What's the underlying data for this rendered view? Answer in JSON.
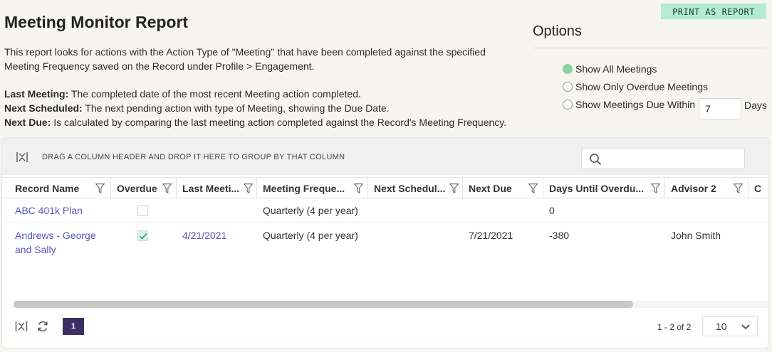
{
  "toolbar": {
    "print_label": "PRINT AS REPORT"
  },
  "page": {
    "title": "Meeting Monitor Report",
    "description": "This report looks for actions with the Action Type of \"Meeting\" that have been completed against the specified Meeting Frequency saved on the Record under Profile > Engagement.",
    "definitions": [
      {
        "term": "Last Meeting:",
        "text": " The completed date of the most recent Meeting action completed."
      },
      {
        "term": "Next Scheduled:",
        "text": " The next pending action with type of Meeting, showing the Due Date."
      },
      {
        "term": "Next Due:",
        "text": " Is calculated by comparing the last meeting action completed against the Record's Meeting Frequency."
      }
    ]
  },
  "options": {
    "title": "Options",
    "radios": [
      {
        "label": "Show All Meetings",
        "checked": true
      },
      {
        "label": "Show Only Overdue Meetings",
        "checked": false
      },
      {
        "label": "Show Meetings Due Within",
        "checked": false
      }
    ],
    "days_value": "7",
    "days_suffix": "Days"
  },
  "grid": {
    "group_hint": "DRAG A COLUMN HEADER AND DROP IT HERE TO GROUP BY THAT COLUMN",
    "search_value": "",
    "columns": [
      "Record Name",
      "Overdue",
      "Last Meeti...",
      "Meeting Freque...",
      "Next Schedul...",
      "Next Due",
      "Days Until Overdu...",
      "Advisor 2",
      "C"
    ],
    "rows": [
      {
        "record_name": "ABC 401k Plan",
        "overdue": false,
        "last_meeting": "",
        "frequency": "Quarterly (4 per year)",
        "next_scheduled": "",
        "next_due": "",
        "days_until_overdue": "0",
        "advisor2": ""
      },
      {
        "record_name": "Andrews - George and Sally",
        "overdue": true,
        "last_meeting": "4/21/2021",
        "frequency": "Quarterly (4 per year)",
        "next_scheduled": "",
        "next_due": "7/21/2021",
        "days_until_overdue": "-380",
        "advisor2": "John Smith"
      }
    ],
    "pager": {
      "current_page": "1",
      "info": "1 - 2 of 2",
      "page_size": "10"
    }
  },
  "colors": {
    "accent": "#b3ecd2",
    "link": "#5a55c0",
    "pager": "#3b2f64",
    "radio_checked": "#8fd19e"
  }
}
